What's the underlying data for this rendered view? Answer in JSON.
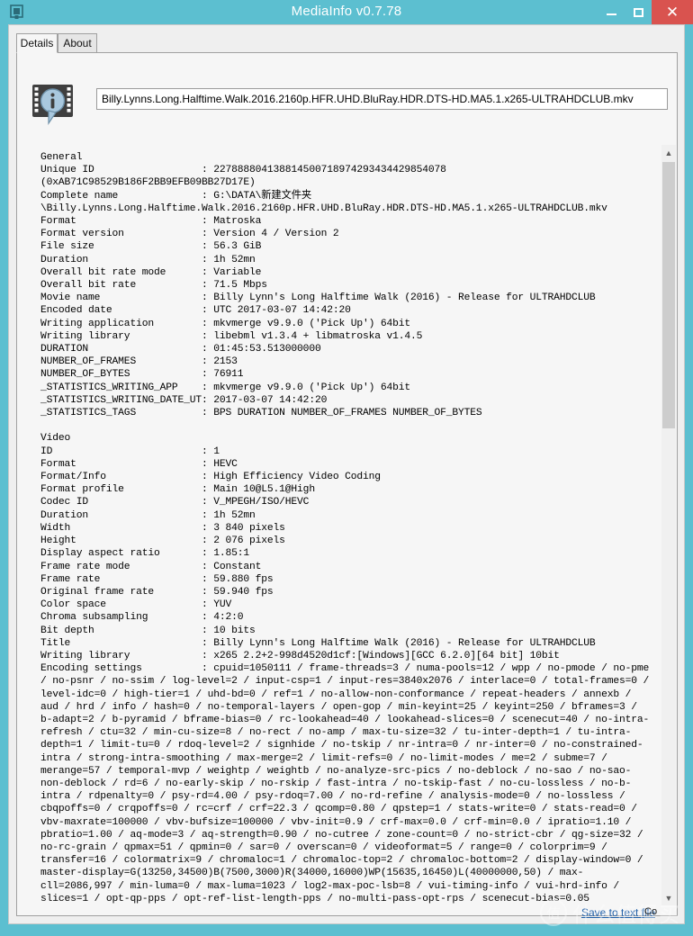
{
  "window": {
    "title": "MediaInfo v0.7.78",
    "app_icon": "mediainfo-app-icon",
    "accent_color": "#5cbfd0",
    "close_color": "#d9534f",
    "controls": {
      "minimize": "–",
      "maximize": "☐",
      "close": "✕"
    }
  },
  "tabs": [
    {
      "id": "details",
      "label": "Details",
      "selected": true
    },
    {
      "id": "about",
      "label": "About",
      "selected": false
    }
  ],
  "logo": {
    "icon": "mediainfo-filmstrip-info-icon"
  },
  "filename_field": {
    "value": "Billy.Lynns.Long.Halftime.Walk.2016.2160p.HFR.UHD.BluRay.HDR.DTS-HD.MA5.1.x265-ULTRAHDCLUB.mkv",
    "placeholder": ""
  },
  "scrollbar": {
    "up_arrow": "▲",
    "down_arrow": "▼",
    "thumb_position_pct": 0,
    "thumb_size_pct": 35
  },
  "actions": {
    "save_to_text_file": "Save to text file"
  },
  "watermark": {
    "circle_glyph": "值",
    "text": "什么值得买"
  },
  "cursor_label": "Cᴏ",
  "info": {
    "sections": [
      {
        "name": "General",
        "rows": [
          {
            "key": "Unique ID",
            "value": "227888804138814500718974293434429854078\n(0xAB71C98529B186F2BB9EFB09BB27D17E)"
          },
          {
            "key": "Complete name",
            "value": "G:\\DATA\\新建文件夹\n\\Billy.Lynns.Long.Halftime.Walk.2016.2160p.HFR.UHD.BluRay.HDR.DTS-HD.MA5.1.x265-ULTRAHDCLUB.mkv"
          },
          {
            "key": "Format",
            "value": "Matroska"
          },
          {
            "key": "Format version",
            "value": "Version 4 / Version 2"
          },
          {
            "key": "File size",
            "value": "56.3 GiB"
          },
          {
            "key": "Duration",
            "value": "1h 52mn"
          },
          {
            "key": "Overall bit rate mode",
            "value": "Variable"
          },
          {
            "key": "Overall bit rate",
            "value": "71.5 Mbps"
          },
          {
            "key": "Movie name",
            "value": "Billy Lynn's Long Halftime Walk (2016) - Release for ULTRAHDCLUB"
          },
          {
            "key": "Encoded date",
            "value": "UTC 2017-03-07 14:42:20"
          },
          {
            "key": "Writing application",
            "value": "mkvmerge v9.9.0 ('Pick Up') 64bit"
          },
          {
            "key": "Writing library",
            "value": "libebml v1.3.4 + libmatroska v1.4.5"
          },
          {
            "key": "DURATION",
            "value": "01:45:53.513000000"
          },
          {
            "key": "NUMBER_OF_FRAMES",
            "value": "2153"
          },
          {
            "key": "NUMBER_OF_BYTES",
            "value": "76911"
          },
          {
            "key": "_STATISTICS_WRITING_APP",
            "value": "mkvmerge v9.9.0 ('Pick Up') 64bit"
          },
          {
            "key": "_STATISTICS_WRITING_DATE_UT",
            "value": "2017-03-07 14:42:20"
          },
          {
            "key": "_STATISTICS_TAGS",
            "value": "BPS DURATION NUMBER_OF_FRAMES NUMBER_OF_BYTES"
          }
        ]
      },
      {
        "name": "Video",
        "rows": [
          {
            "key": "ID",
            "value": "1"
          },
          {
            "key": "Format",
            "value": "HEVC"
          },
          {
            "key": "Format/Info",
            "value": "High Efficiency Video Coding"
          },
          {
            "key": "Format profile",
            "value": "Main 10@L5.1@High"
          },
          {
            "key": "Codec ID",
            "value": "V_MPEGH/ISO/HEVC"
          },
          {
            "key": "Duration",
            "value": "1h 52mn"
          },
          {
            "key": "Width",
            "value": "3 840 pixels"
          },
          {
            "key": "Height",
            "value": "2 076 pixels"
          },
          {
            "key": "Display aspect ratio",
            "value": "1.85:1"
          },
          {
            "key": "Frame rate mode",
            "value": "Constant"
          },
          {
            "key": "Frame rate",
            "value": "59.880 fps"
          },
          {
            "key": "Original frame rate",
            "value": "59.940 fps"
          },
          {
            "key": "Color space",
            "value": "YUV"
          },
          {
            "key": "Chroma subsampling",
            "value": "4:2:0"
          },
          {
            "key": "Bit depth",
            "value": "10 bits"
          },
          {
            "key": "Title",
            "value": "Billy Lynn's Long Halftime Walk (2016) - Release for ULTRAHDCLUB"
          },
          {
            "key": "Writing library",
            "value": "x265 2.2+2-998d4520d1cf:[Windows][GCC 6.2.0][64 bit] 10bit"
          },
          {
            "key": "Encoding settings",
            "value": "cpuid=1050111 / frame-threads=3 / numa-pools=12 / wpp / no-pmode / no-pme / no-psnr / no-ssim / log-level=2 / input-csp=1 / input-res=3840x2076 / interlace=0 / total-frames=0 / level-idc=0 / high-tier=1 / uhd-bd=0 / ref=1 / no-allow-non-conformance / repeat-headers / annexb / aud / hrd / info / hash=0 / no-temporal-layers / open-gop / min-keyint=25 / keyint=250 / bframes=3 / b-adapt=2 / b-pyramid / bframe-bias=0 / rc-lookahead=40 / lookahead-slices=0 / scenecut=40 / no-intra-refresh / ctu=32 / min-cu-size=8 / no-rect / no-amp / max-tu-size=32 / tu-inter-depth=1 / tu-intra-depth=1 / limit-tu=0 / rdoq-level=2 / signhide / no-tskip / nr-intra=0 / nr-inter=0 / no-constrained-intra / strong-intra-smoothing / max-merge=2 / limit-refs=0 / no-limit-modes / me=2 / subme=7 / merange=57 / temporal-mvp / weightp / weightb / no-analyze-src-pics / no-deblock / no-sao / no-sao-non-deblock / rd=6 / no-early-skip / no-rskip / fast-intra / no-tskip-fast / no-cu-lossless / no-b-intra / rdpenalty=0 / psy-rd=4.00 / psy-rdoq=7.00 / no-rd-refine / analysis-mode=0 / no-lossless / cbqpoffs=0 / crqpoffs=0 / rc=crf / crf=22.3 / qcomp=0.80 / qpstep=1 / stats-write=0 / stats-read=0 / vbv-maxrate=100000 / vbv-bufsize=100000 / vbv-init=0.9 / crf-max=0.0 / crf-min=0.0 / ipratio=1.10 / pbratio=1.00 / aq-mode=3 / aq-strength=0.90 / no-cutree / zone-count=0 / no-strict-cbr / qg-size=32 / no-rc-grain / qpmax=51 / qpmin=0 / sar=0 / overscan=0 / videoformat=5 / range=0 / colorprim=9 / transfer=16 / colormatrix=9 / chromaloc=1 / chromaloc-top=2 / chromaloc-bottom=2 / display-window=0 / master-display=G(13250,34500)B(7500,3000)R(34000,16000)WP(15635,16450)L(40000000,50) / max-cll=2086,997 / min-luma=0 / max-luma=1023 / log2-max-poc-lsb=8 / vui-timing-info / vui-hrd-info / slices=1 / opt-qp-pps / opt-ref-list-length-pps / no-multi-pass-opt-rps / scenecut-bias=0.05"
          }
        ]
      }
    ]
  }
}
